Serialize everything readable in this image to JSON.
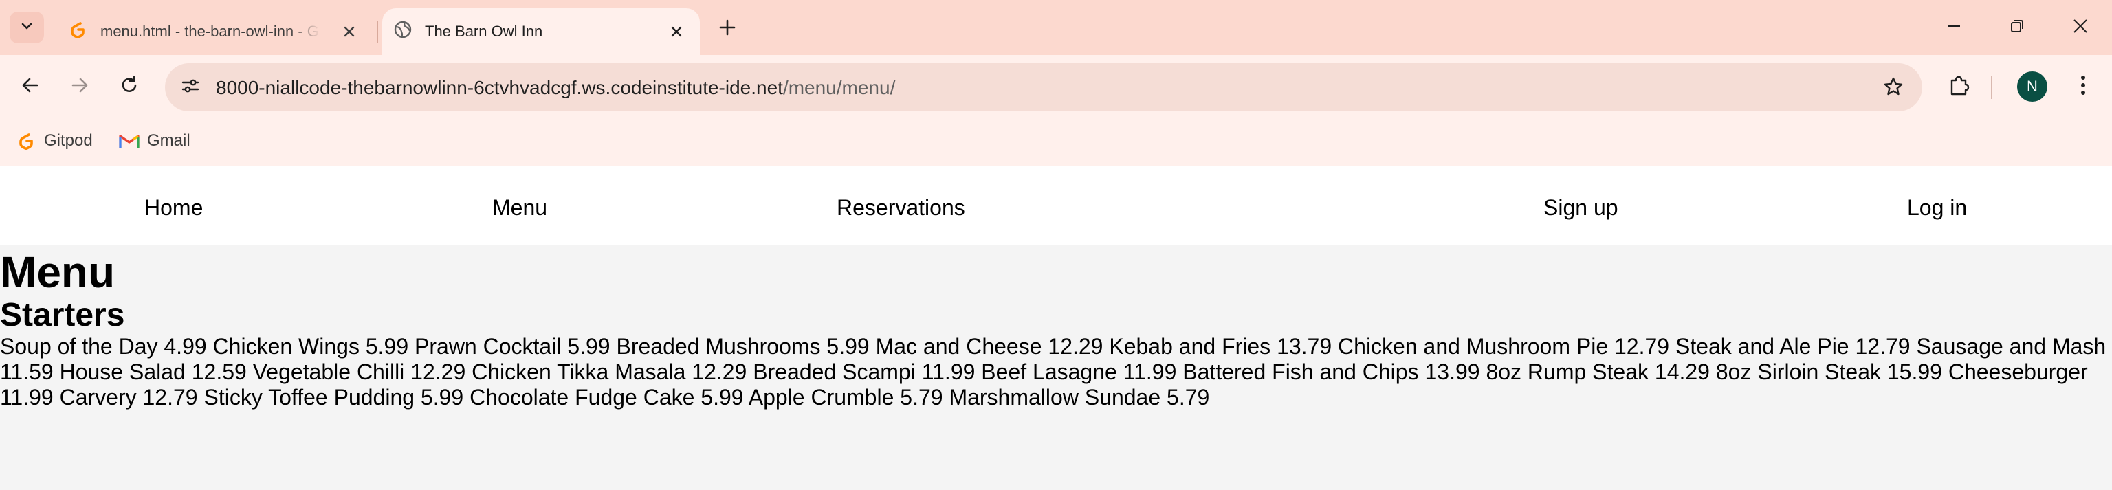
{
  "browser": {
    "tabs": [
      {
        "title": "menu.html - the-barn-owl-inn - Gitpod",
        "active": false,
        "icon": "gitpod-icon"
      },
      {
        "title": "The Barn Owl Inn",
        "active": true,
        "icon": "globe-icon"
      }
    ],
    "url_host": "8000-niallcode-thebarnowlinn-6ctvhvadcgf.ws.codeinstitute-ide.net",
    "url_path": "/menu/menu/",
    "avatar_letter": "N",
    "bookmarks": [
      {
        "label": "Gitpod",
        "icon": "gitpod-icon"
      },
      {
        "label": "Gmail",
        "icon": "gmail-icon"
      }
    ],
    "colors": {
      "tabstrip": "#fcd9cf",
      "toolbar": "#fff0ec",
      "avatar": "#0a4f43"
    }
  },
  "site": {
    "nav": {
      "home": "Home",
      "menu": "Menu",
      "reservations": "Reservations",
      "signup": "Sign up",
      "login": "Log in"
    },
    "page_title": "Menu",
    "section_title": "Starters",
    "items": [
      {
        "name": "Soup of the Day",
        "price": "4.99"
      },
      {
        "name": "Chicken Wings",
        "price": "5.99"
      },
      {
        "name": "Prawn Cocktail",
        "price": "5.99"
      },
      {
        "name": "Breaded Mushrooms",
        "price": "5.99"
      },
      {
        "name": "Mac and Cheese",
        "price": "12.29"
      },
      {
        "name": "Kebab and Fries",
        "price": "13.79"
      },
      {
        "name": "Chicken and Mushroom Pie",
        "price": "12.79"
      },
      {
        "name": "Steak and Ale Pie",
        "price": "12.79"
      },
      {
        "name": "Sausage and Mash",
        "price": "11.59"
      },
      {
        "name": "House Salad",
        "price": "12.59"
      },
      {
        "name": "Vegetable Chilli",
        "price": "12.29"
      },
      {
        "name": "Chicken Tikka Masala",
        "price": "12.29"
      },
      {
        "name": "Breaded Scampi",
        "price": "11.99"
      },
      {
        "name": "Beef Lasagne",
        "price": "11.99"
      },
      {
        "name": "Battered Fish and Chips",
        "price": "13.99"
      },
      {
        "name": "8oz Rump Steak",
        "price": "14.29"
      },
      {
        "name": "8oz Sirloin Steak",
        "price": "15.99"
      },
      {
        "name": "Cheeseburger",
        "price": "11.99"
      },
      {
        "name": "Carvery",
        "price": "12.79"
      },
      {
        "name": "Sticky Toffee Pudding",
        "price": "5.99"
      },
      {
        "name": "Chocolate Fudge Cake",
        "price": "5.99"
      },
      {
        "name": "Apple Crumble",
        "price": "5.79"
      },
      {
        "name": "Marshmallow Sundae",
        "price": "5.79"
      }
    ]
  }
}
